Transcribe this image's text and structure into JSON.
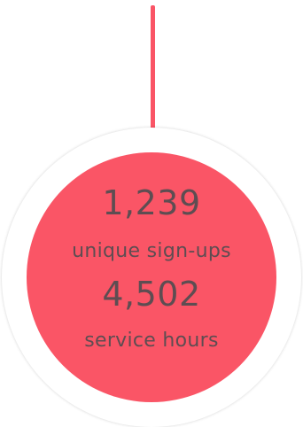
{
  "colors": {
    "accent": "#fa5566",
    "text": "#5e4d52",
    "ring": "#ffffff"
  },
  "stats": [
    {
      "value": "1,239",
      "label": "unique sign-ups"
    },
    {
      "value": "4,502",
      "label": "service hours"
    }
  ]
}
